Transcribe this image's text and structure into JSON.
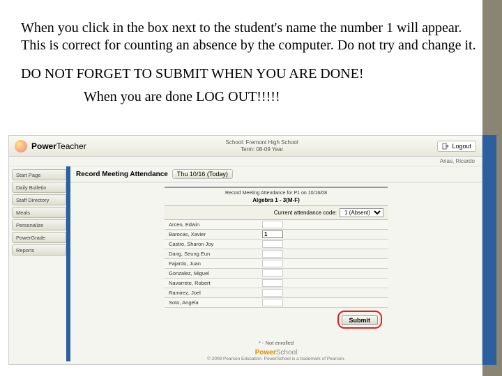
{
  "instruction": "When you click in the box next to the student's name the number 1 will appear. This is correct for counting an absence by the computer. Do not try and change it.",
  "warning_line1": "DO NOT FORGET TO SUBMIT WHEN YOU ARE DONE!",
  "warning_line2": "When you are done LOG OUT!!!!!",
  "app": {
    "logo_strong": "Power",
    "logo_thin": "Teacher",
    "school_label": "School:",
    "school_name": "Fremont High School",
    "term_label": "Term:",
    "term_value": "08-09 Year",
    "logout": "Logout",
    "user": "Arias, Ricardo"
  },
  "sidebar": {
    "items": [
      {
        "label": "Start Page"
      },
      {
        "label": "Daily Bulletin"
      },
      {
        "label": "Staff Directory"
      },
      {
        "label": "Meals"
      },
      {
        "label": "Personalize"
      },
      {
        "label": "PowerGrade"
      },
      {
        "label": "Reports"
      }
    ]
  },
  "attendance": {
    "section_title": "Record Meeting Attendance",
    "date_chip": "Thu 10/16 (Today)",
    "caption": "Record Meeting Attendance for P1 on 10/16/08",
    "class_name": "Algebra 1 - 3(M-F)",
    "code_label": "Current attendance code:",
    "code_value": "1 (Absent)",
    "students": [
      {
        "name": "Arceo, Edwin",
        "val": ""
      },
      {
        "name": "Barocas, Xavier",
        "val": "1"
      },
      {
        "name": "Castro, Sharon Joy",
        "val": ""
      },
      {
        "name": "Dang, Seung Eun",
        "val": ""
      },
      {
        "name": "Fajardo, Juan",
        "val": ""
      },
      {
        "name": "Gonzalez, Miguel",
        "val": ""
      },
      {
        "name": "Navarrete, Robert",
        "val": ""
      },
      {
        "name": "Ramirez, Joel",
        "val": ""
      },
      {
        "name": "Soto, Angela",
        "val": ""
      }
    ],
    "submit": "Submit",
    "legend": "* - Not enrolled"
  },
  "footer": {
    "logo1": "Power",
    "logo2": "School",
    "copy": "© 2008 Pearson Education. PowerSchool is a trademark of Pearson."
  }
}
